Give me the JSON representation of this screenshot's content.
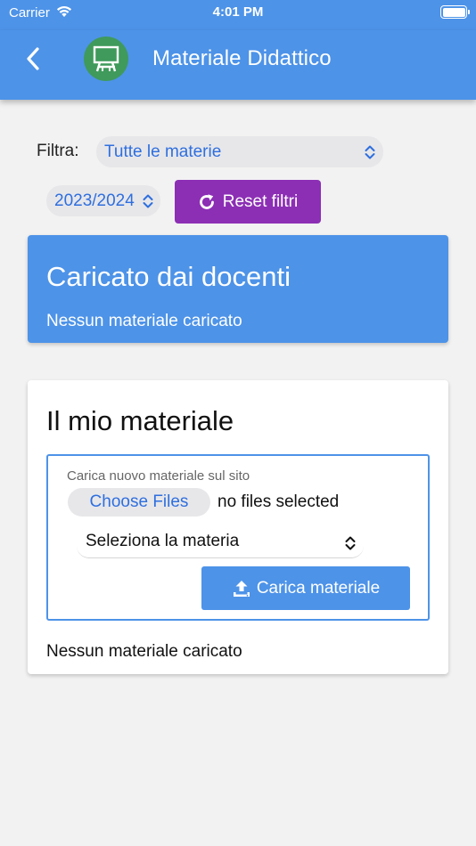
{
  "status_bar": {
    "carrier": "Carrier",
    "time": "4:01 PM",
    "wifi_icon": "wifi-icon",
    "battery_icon": "battery-icon",
    "battery_level": 1.0
  },
  "header": {
    "title": "Materiale Didattico",
    "back_icon": "chevron-left-icon",
    "logo_icon": "blackboard-icon",
    "background_color": "#4d93e8",
    "logo_color": "#3f9a5c"
  },
  "filters": {
    "label": "Filtra:",
    "subject_selected": "Tutte le materie",
    "year_selected": "2023/2024",
    "reset_label": "Reset filtri",
    "reset_icon": "refresh-icon",
    "reset_color": "#8c2fb5"
  },
  "teacher_section": {
    "title": "Caricato dai docenti",
    "empty_text": "Nessun materiale caricato"
  },
  "my_section": {
    "title": "Il mio materiale",
    "upload_caption": "Carica nuovo materiale sul sito",
    "choose_files_label": "Choose Files",
    "no_files_text": "no files selected",
    "subject_select_value": "Seleziona la materia",
    "upload_button_label": "Carica materiale",
    "upload_icon": "upload-icon",
    "empty_text": "Nessun materiale caricato"
  }
}
